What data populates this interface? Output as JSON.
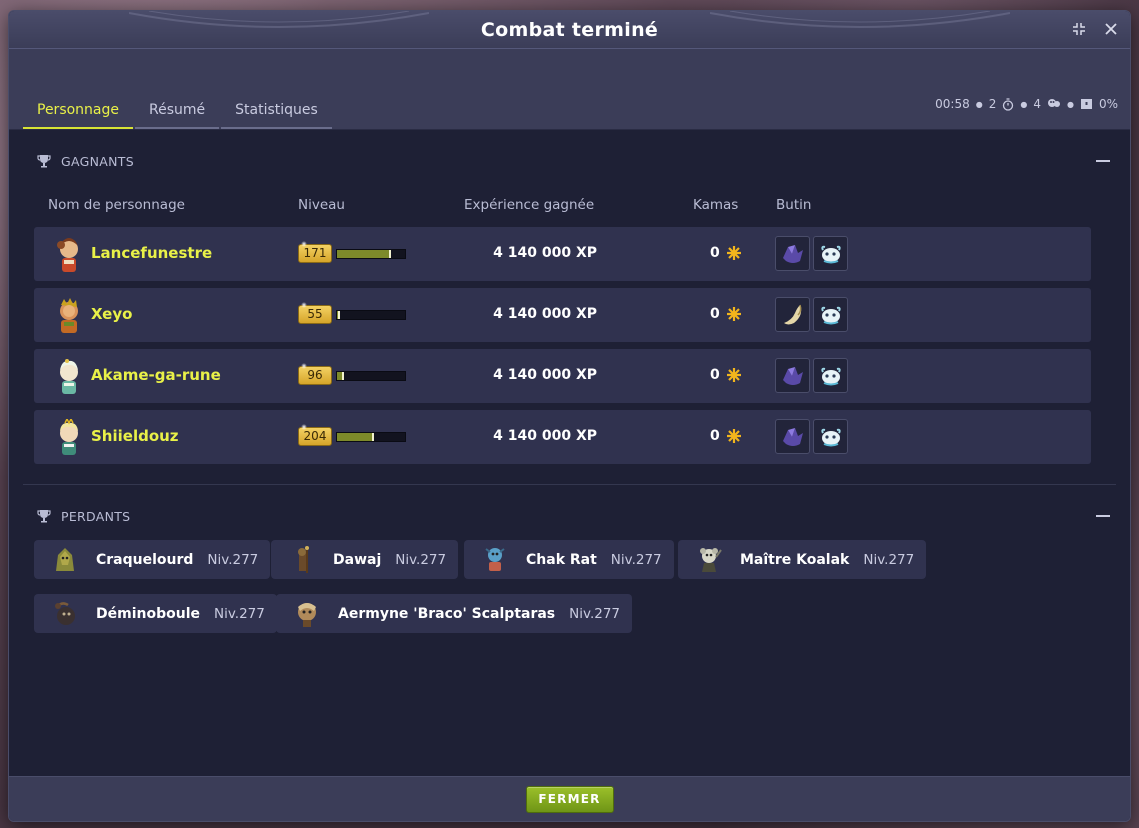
{
  "window": {
    "title": "Combat terminé"
  },
  "tabs": [
    {
      "label": "Personnage",
      "active": true
    },
    {
      "label": "Résumé",
      "active": false
    },
    {
      "label": "Statistiques",
      "active": false
    }
  ],
  "stats": {
    "duration": "00:58",
    "turns": "2",
    "players": "4",
    "challenge": "0%"
  },
  "winners": {
    "heading": "GAGNANTS",
    "columns": {
      "name": "Nom de personnage",
      "level": "Niveau",
      "xp": "Expérience gagnée",
      "kamas": "Kamas",
      "loot": "Butin"
    },
    "rows": [
      {
        "name": "Lancefunestre",
        "level": "171",
        "xp": "4 140 000",
        "kamas": "0",
        "xp_fill": 0.8,
        "loot": [
          "dark-crystal-icon",
          "white-creature-icon"
        ]
      },
      {
        "name": "Xeyo",
        "level": "55",
        "xp": "4 140 000",
        "kamas": "0",
        "xp_fill": 0.05,
        "loot": [
          "horn-icon",
          "white-creature-icon"
        ]
      },
      {
        "name": "Akame-ga-rune",
        "level": "96",
        "xp": "4 140 000",
        "kamas": "0",
        "xp_fill": 0.1,
        "loot": [
          "dark-crystal-icon",
          "white-creature-icon"
        ]
      },
      {
        "name": "Shiieldouz",
        "level": "204",
        "xp": "4 140 000",
        "kamas": "0",
        "xp_fill": 0.55,
        "loot": [
          "dark-crystal-icon",
          "white-creature-icon"
        ]
      }
    ],
    "xp_unit": "XP"
  },
  "losers": {
    "heading": "PERDANTS",
    "items": [
      {
        "name": "Craquelourd",
        "level": "Niv.277"
      },
      {
        "name": "Dawaj",
        "level": "Niv.277"
      },
      {
        "name": "Chak Rat",
        "level": "Niv.277"
      },
      {
        "name": "Maître Koalak",
        "level": "Niv.277"
      },
      {
        "name": "Déminoboule",
        "level": "Niv.277"
      },
      {
        "name": "Aermyne 'Braco' Scalptaras",
        "level": "Niv.277"
      }
    ]
  },
  "footer": {
    "close_label": "FERMER"
  },
  "colors": {
    "accent": "#e9f148",
    "button": "#8ab022",
    "panel": "#30324f"
  }
}
